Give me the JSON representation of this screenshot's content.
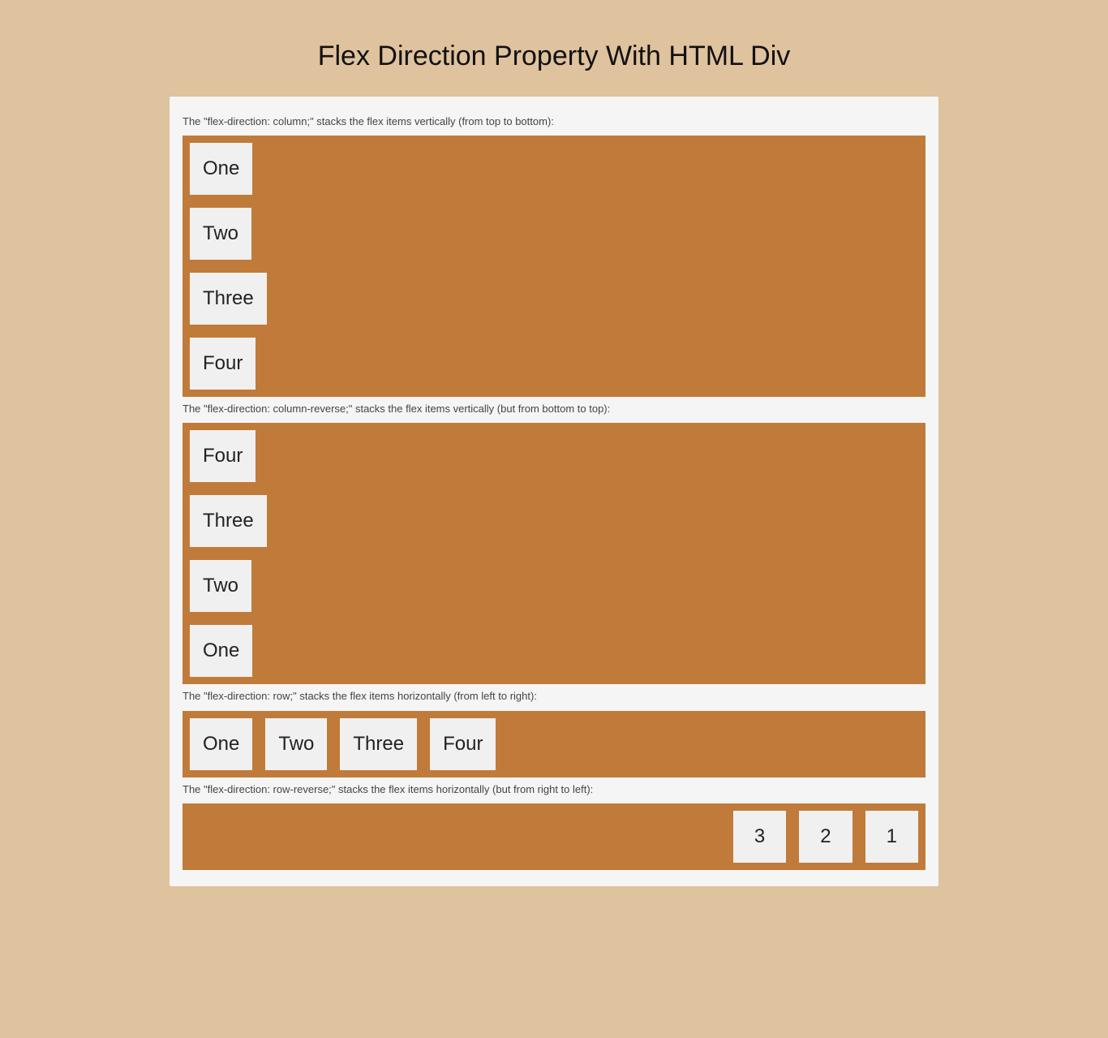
{
  "title": "Flex Direction Property With HTML Div",
  "sections": {
    "column": {
      "caption": "The \"flex-direction: column;\" stacks the flex items vertically (from top to bottom):",
      "items": [
        "One",
        "Two",
        "Three",
        "Four"
      ]
    },
    "column_reverse": {
      "caption": "The \"flex-direction: column-reverse;\" stacks the flex items vertically (but from bottom to top):",
      "items": [
        "One",
        "Two",
        "Three",
        "Four"
      ]
    },
    "row": {
      "caption": "The \"flex-direction: row;\" stacks the flex items horizontally (from left to right):",
      "items": [
        "One",
        "Two",
        "Three",
        "Four"
      ]
    },
    "row_reverse": {
      "caption": "The \"flex-direction: row-reverse;\" stacks the flex items horizontally (but from right to left):",
      "items": [
        "1",
        "2",
        "3"
      ]
    }
  },
  "colors": {
    "page_bg": "#dfc29e",
    "container_bg": "#f5f5f5",
    "flex_bg": "#c07b3a",
    "item_bg": "#f0f0f0"
  }
}
